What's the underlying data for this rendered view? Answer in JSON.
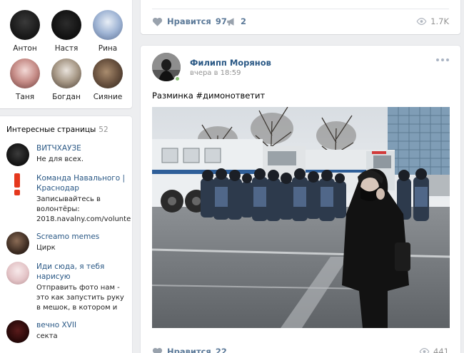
{
  "friends": [
    {
      "name": "Антон"
    },
    {
      "name": "Настя"
    },
    {
      "name": "Рина"
    },
    {
      "name": "Таня"
    },
    {
      "name": "Богдан"
    },
    {
      "name": "Сияние"
    }
  ],
  "pages": {
    "title": "Интересные страницы",
    "count": "52",
    "items": [
      {
        "name": "ВИТЧХАУЗЕ",
        "desc": "Не для всех."
      },
      {
        "name": "Команда Навального | Краснодар",
        "desc": "Записывайтесь в волонтёры: 2018.navalny.com/volunte"
      },
      {
        "name": "Screamo memes",
        "desc": "Цирк"
      },
      {
        "name": "Иди сюда, я тебя нарисую",
        "desc": "Отправить фото нам - это как запустить руку в мешок, в котором и"
      },
      {
        "name": "вечно XVII",
        "desc": "секта"
      }
    ]
  },
  "post1": {
    "like_label": "Нравится",
    "like_count": "97",
    "share_count": "2",
    "views": "1.7K"
  },
  "post2": {
    "author": "Филипп Морянов",
    "time": "вчера в 18:59",
    "text": "Разминка #димонответит",
    "like_label": "Нравится",
    "like_count": "22",
    "views": "441"
  },
  "colors": {
    "background": "#edeef0",
    "link": "#2a5885",
    "action": "#5c7a99",
    "muted": "#939393",
    "online": "#8ac176"
  },
  "icons": {
    "like": "heart-icon",
    "share": "megaphone-icon",
    "views": "eye-icon",
    "more": "more-dots-icon"
  }
}
